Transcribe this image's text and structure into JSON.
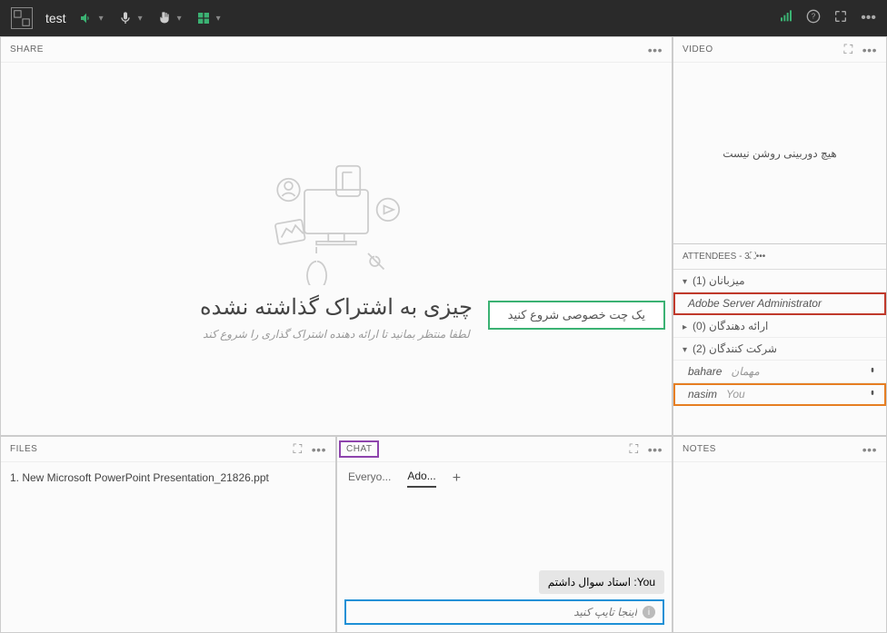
{
  "topbar": {
    "meeting_name": "test"
  },
  "share": {
    "title": "SHARE",
    "heading": "چیزی به اشتراک گذاشته نشده",
    "subheading": "لطفا منتظر بمانید تا ارائه دهنده اشتراک گذاری را شروع کند",
    "tooltip": "یک چت خصوصی شروع کنید"
  },
  "video": {
    "title": "VIDEO",
    "empty_msg": "هیچ دوربینی روشن نیست"
  },
  "attendees": {
    "title": "ATTENDEES",
    "count": "- 3",
    "groups": {
      "hosts": {
        "label": "میزبانان (1)",
        "items": [
          {
            "name": "Adobe Server Administrator",
            "role": ""
          }
        ]
      },
      "presenters": {
        "label": "ارائه دهندگان (0)",
        "items": []
      },
      "participants": {
        "label": "شرکت کنندگان (2)",
        "items": [
          {
            "name": "bahare",
            "role": "مهمان"
          },
          {
            "name": "nasim",
            "role": "You"
          }
        ]
      }
    }
  },
  "files": {
    "title": "FILES",
    "items": [
      "1. New Microsoft PowerPoint Presentation_21826.ppt"
    ]
  },
  "chat": {
    "title": "CHAT",
    "tabs": {
      "everyone": "Everyo...",
      "adobe": "Ado..."
    },
    "messages": [
      {
        "sender": "You",
        "text": "استاد سوال داشتم"
      }
    ],
    "placeholder": "اینجا تایپ کنید"
  },
  "notes": {
    "title": "NOTES"
  }
}
